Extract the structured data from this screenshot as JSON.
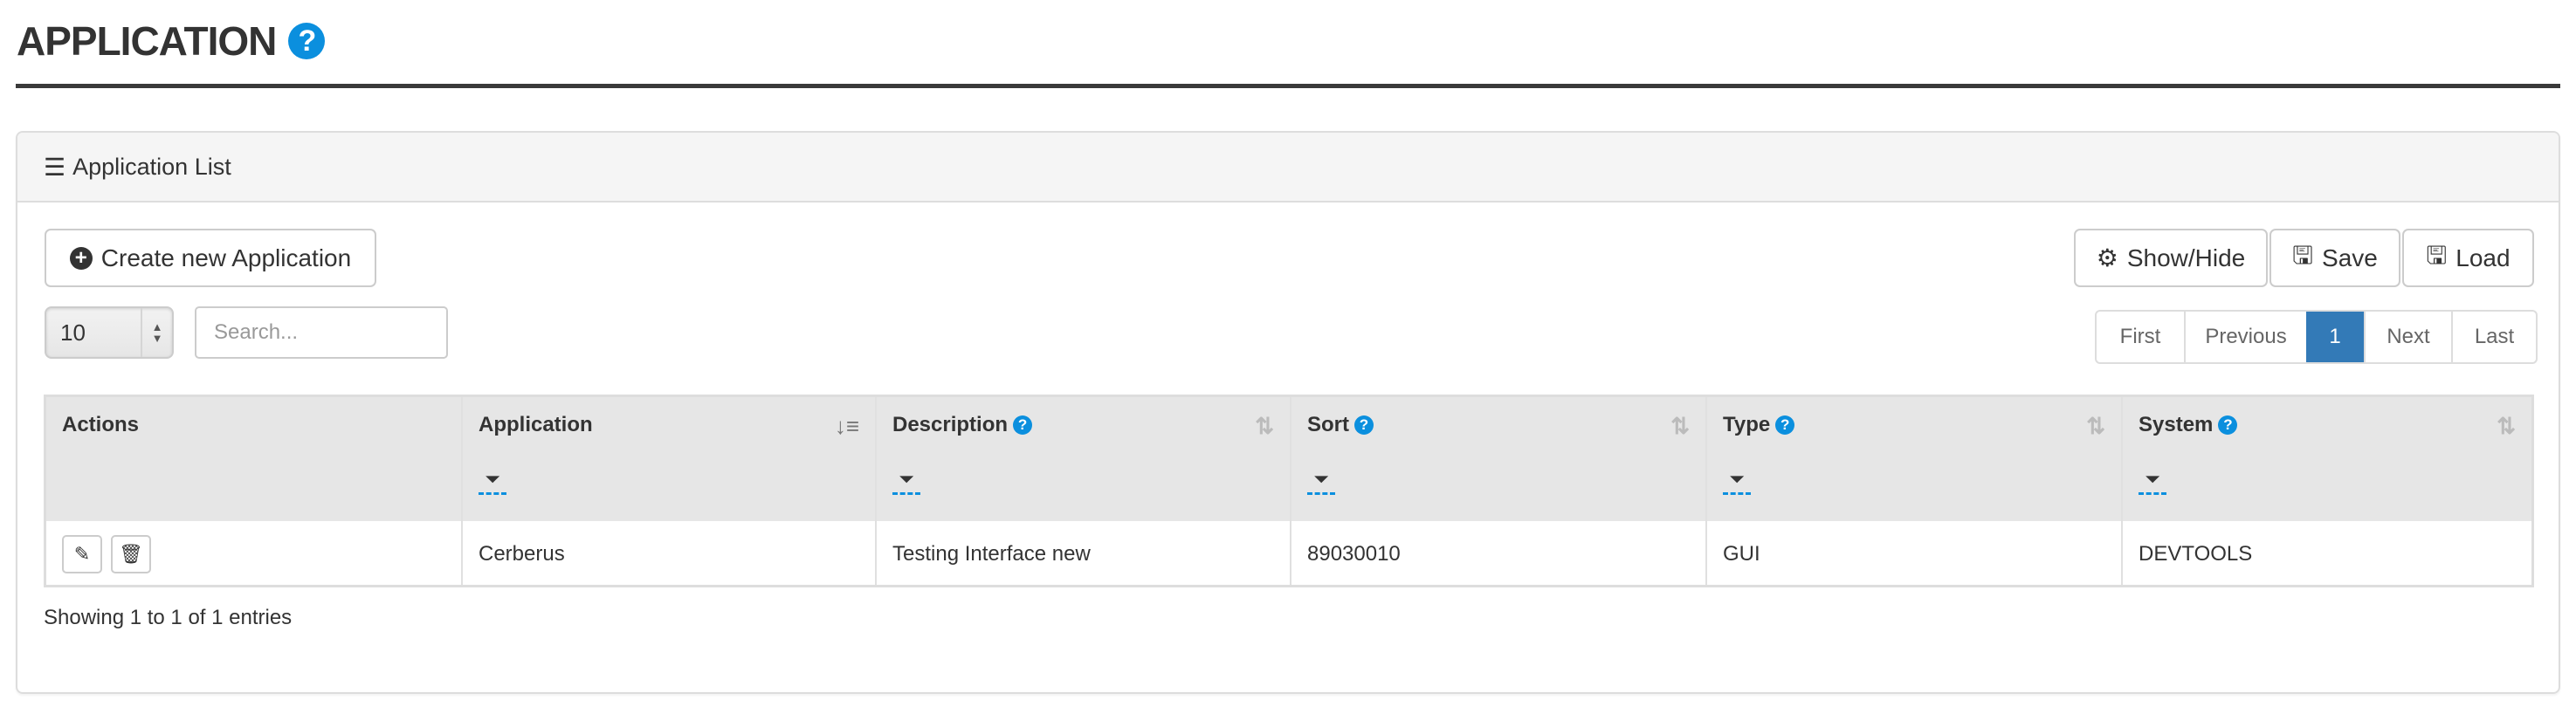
{
  "header": {
    "title": "APPLICATION",
    "help_icon": "question-circle-icon"
  },
  "panel": {
    "title": "Application List",
    "icon": "list-icon"
  },
  "toolbar": {
    "create_label": "Create new Application",
    "showhide_label": "Show/Hide",
    "save_label": "Save",
    "load_label": "Load"
  },
  "length_select": {
    "value": "10"
  },
  "search": {
    "placeholder": "Search...",
    "value": ""
  },
  "pagination": {
    "first": "First",
    "previous": "Previous",
    "current": "1",
    "next": "Next",
    "last": "Last"
  },
  "table": {
    "columns": [
      {
        "label": "Actions",
        "help": false,
        "sortable": false,
        "filter": false
      },
      {
        "label": "Application",
        "help": false,
        "sortable": true,
        "sorted": "asc",
        "filter": true
      },
      {
        "label": "Description",
        "help": true,
        "sortable": true,
        "filter": true
      },
      {
        "label": "Sort",
        "help": true,
        "sortable": true,
        "filter": true
      },
      {
        "label": "Type",
        "help": true,
        "sortable": true,
        "filter": true
      },
      {
        "label": "System",
        "help": true,
        "sortable": true,
        "filter": true
      }
    ],
    "rows": [
      {
        "application": "Cerberus",
        "description": "Testing Interface new",
        "sort": "89030010",
        "type": "GUI",
        "system": "DEVTOOLS"
      }
    ]
  },
  "info": "Showing 1 to 1 of 1 entries",
  "colors": {
    "accent": "#337ab7",
    "help": "#0b8fde",
    "header_bg": "#e6e6e6"
  }
}
